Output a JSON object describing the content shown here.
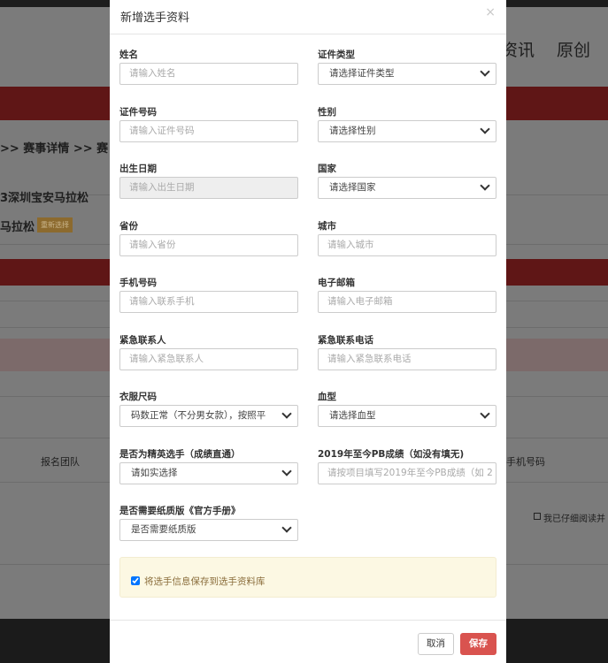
{
  "background": {
    "nav_items": [
      "资讯",
      "原创"
    ],
    "breadcrumb": ">> 赛事详情 >> 赛",
    "event_name": "3深圳宝安马拉松",
    "event_short": "马拉松",
    "reselect_badge": "重新选择",
    "table_col_team": "报名团队",
    "table_col_phone": "手机号码",
    "agree_text": "我已仔细阅读并"
  },
  "modal": {
    "title": "新增选手资料",
    "close_icon": "×",
    "fields": [
      {
        "label": "姓名",
        "type": "input",
        "placeholder": "请输入姓名"
      },
      {
        "label": "证件类型",
        "type": "select",
        "value": "请选择证件类型"
      },
      {
        "label": "证件号码",
        "type": "input",
        "placeholder": "请输入证件号码"
      },
      {
        "label": "性别",
        "type": "select",
        "value": "请选择性别"
      },
      {
        "label": "出生日期",
        "type": "input",
        "placeholder": "请输入出生日期",
        "disabled": true
      },
      {
        "label": "国家",
        "type": "select",
        "value": "请选择国家"
      },
      {
        "label": "省份",
        "type": "input",
        "placeholder": "请输入省份"
      },
      {
        "label": "城市",
        "type": "input",
        "placeholder": "请输入城市"
      },
      {
        "label": "手机号码",
        "type": "input",
        "placeholder": "请输入联系手机"
      },
      {
        "label": "电子邮箱",
        "type": "input",
        "placeholder": "请输入电子邮箱"
      },
      {
        "label": "紧急联系人",
        "type": "input",
        "placeholder": "请输入紧急联系人"
      },
      {
        "label": "紧急联系电话",
        "type": "input",
        "placeholder": "请输入紧急联系电话"
      },
      {
        "label": "衣服尺码",
        "type": "select",
        "value": "码数正常（不分男女款），按照平"
      },
      {
        "label": "血型",
        "type": "select",
        "value": "请选择血型"
      },
      {
        "label": "是否为精英选手（成绩直通）",
        "type": "select",
        "value": "请如实选择"
      },
      {
        "label": "2019年至今PB成绩（如没有填无)",
        "type": "input",
        "placeholder": "请按项目填写2019年至今PB成绩（如 2"
      },
      {
        "label": "是否需要纸质版《官方手册》",
        "type": "select",
        "value": "是否需要纸质版"
      }
    ],
    "save_to_library": {
      "label": "将选手信息保存到选手资料库",
      "checked": true
    },
    "cancel_label": "取消",
    "save_label": "保存",
    "colors": {
      "primary_red": "#d9534f",
      "notice_bg": "#fcf8e3"
    }
  }
}
